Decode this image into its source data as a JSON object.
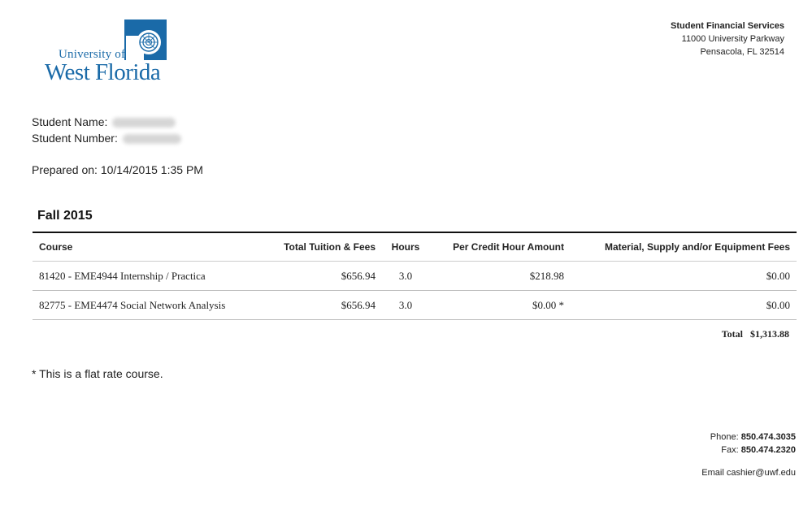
{
  "header": {
    "university_line1": "University of",
    "university_line2": "West Florida",
    "office_name": "Student Financial Services",
    "address_line1": "11000 University Parkway",
    "address_line2": "Pensacola, FL 32514"
  },
  "student": {
    "name_label": "Student Name:",
    "number_label": "Student Number:",
    "prepared_label": "Prepared on:",
    "prepared_value": "10/14/2015 1:35 PM"
  },
  "term": "Fall 2015",
  "table": {
    "headers": [
      "Course",
      "Total Tuition & Fees",
      "Hours",
      "Per Credit Hour Amount",
      "Material, Supply and/or Equipment Fees"
    ],
    "rows": [
      [
        "81420 - EME4944 Internship / Practica",
        "$656.94",
        "3.0",
        "$218.98",
        "$0.00"
      ],
      [
        "82775 - EME4474 Social Network Analysis",
        "$656.94",
        "3.0",
        "$0.00 *",
        "$0.00"
      ]
    ]
  },
  "total": {
    "label": "Total",
    "value": "$1,313.88"
  },
  "footnote": "* This is a flat rate course.",
  "contact": {
    "phone_label": "Phone:",
    "phone": "850.474.3035",
    "fax_label": "Fax:",
    "fax": "850.474.2320",
    "email_label": "Email",
    "email": "cashier@uwf.edu"
  },
  "colors": {
    "brand": "#1a6aa8",
    "rule": "#111111"
  }
}
